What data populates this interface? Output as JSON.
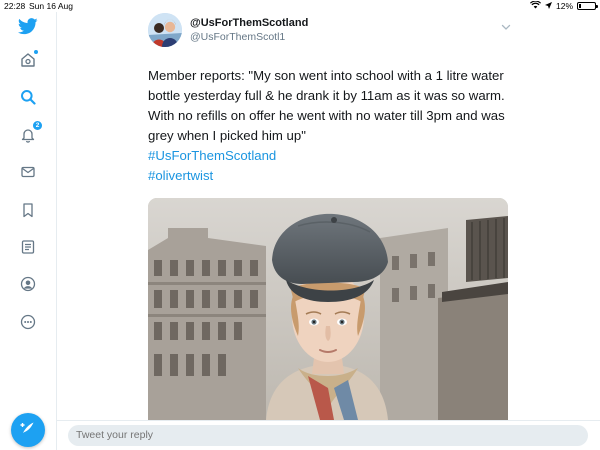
{
  "status_bar": {
    "time": "22:28",
    "date": "Sun 16 Aug",
    "battery": "12%",
    "battery_level": 0.12
  },
  "nav": {
    "items": [
      {
        "name": "twitter-logo-icon"
      },
      {
        "name": "home-icon"
      },
      {
        "name": "search-icon"
      },
      {
        "name": "notifications-icon",
        "badge": "2"
      },
      {
        "name": "messages-icon"
      },
      {
        "name": "bookmarks-icon"
      },
      {
        "name": "lists-icon"
      },
      {
        "name": "profile-icon"
      },
      {
        "name": "more-icon"
      }
    ],
    "compose_icon": "compose-tweet-icon"
  },
  "tweet": {
    "display_name": "@UsForThemScotland",
    "handle": "@UsForThemScotl1",
    "text": "Member reports: \"My son went into school with a 1 litre water bottle yesterday full & he drank it by 11am as it was so warm. With no refills on offer he went with no water till 3pm and was grey when I picked him up\"",
    "hashtags": [
      "#UsForThemScotland",
      "#olivertwist"
    ]
  },
  "reply": {
    "placeholder": "Tweet your reply"
  },
  "colors": {
    "accent": "#1da1f2",
    "link": "#1b95e0",
    "text": "#14171a",
    "muted": "#657786",
    "border": "#e6ecf0"
  }
}
